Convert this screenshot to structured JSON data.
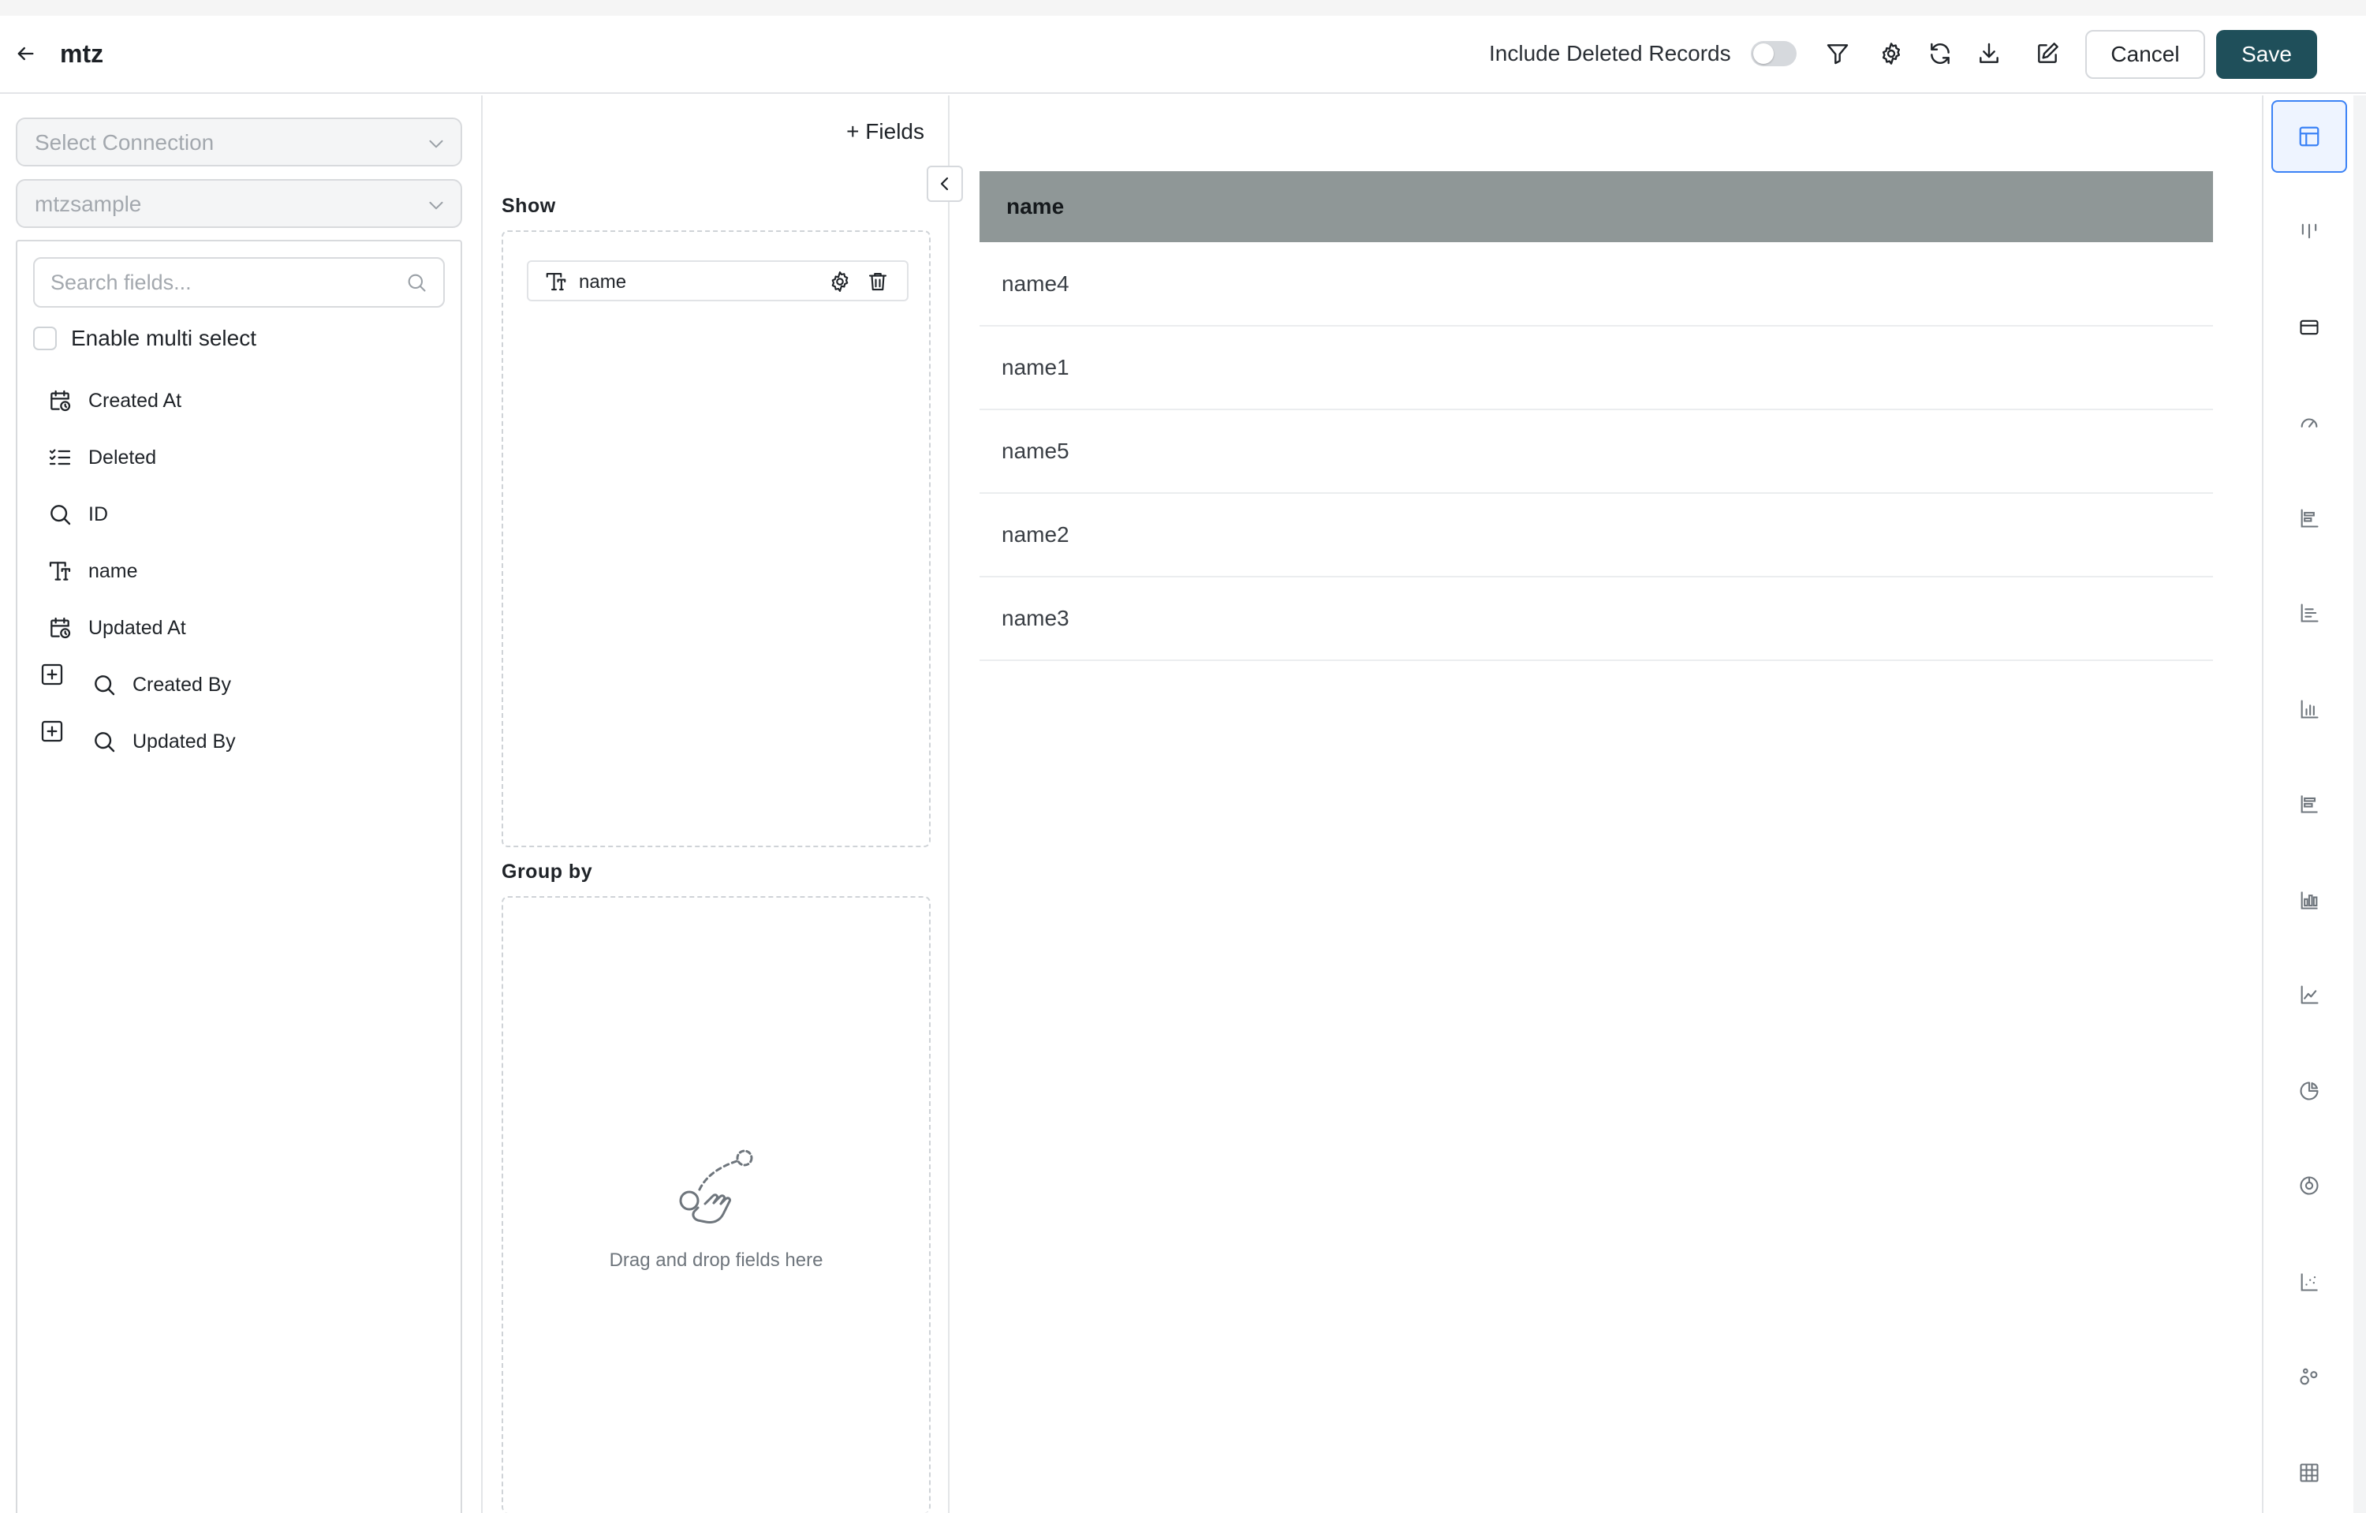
{
  "header": {
    "title": "mtz",
    "include_deleted_label": "Include Deleted Records",
    "include_deleted_on": false,
    "cancel_label": "Cancel",
    "save_label": "Save",
    "save_color": "#1f4f5a"
  },
  "left": {
    "connection_placeholder": "Select Connection",
    "source_value": "mtzsample",
    "search_placeholder": "Search fields...",
    "multi_select_label": "Enable multi select",
    "fields": [
      {
        "label": "Created At",
        "icon": "calendar-clock-icon"
      },
      {
        "label": "Deleted",
        "icon": "checklist-icon"
      },
      {
        "label": "ID",
        "icon": "search-icon"
      },
      {
        "label": "name",
        "icon": "text-type-icon"
      },
      {
        "label": "Updated At",
        "icon": "calendar-clock-icon"
      },
      {
        "label": "Created By",
        "icon": "search-icon",
        "expandable": true
      },
      {
        "label": "Updated By",
        "icon": "search-icon",
        "expandable": true
      }
    ]
  },
  "middle": {
    "add_fields_label": "+ Fields",
    "show_label": "Show",
    "show_fields": [
      {
        "label": "name"
      }
    ],
    "group_by_label": "Group by",
    "drop_hint": "Drag and drop fields here"
  },
  "table": {
    "columns": [
      "name"
    ],
    "rows": [
      "name4",
      "name1",
      "name5",
      "name2",
      "name3"
    ],
    "header_color": "#8f9797"
  },
  "rail": {
    "active_index": 0,
    "items": [
      "table-view-icon",
      "column-chart-icon",
      "card-icon",
      "gauge-icon",
      "horizontal-bar-icon",
      "bar-chart-icon",
      "vertical-bar-icon",
      "stacked-bar-icon",
      "grouped-bar-icon",
      "line-chart-icon",
      "pie-chart-icon",
      "donut-chart-icon",
      "scatter-chart-icon",
      "bubble-chart-icon",
      "pivot-table-icon"
    ]
  }
}
